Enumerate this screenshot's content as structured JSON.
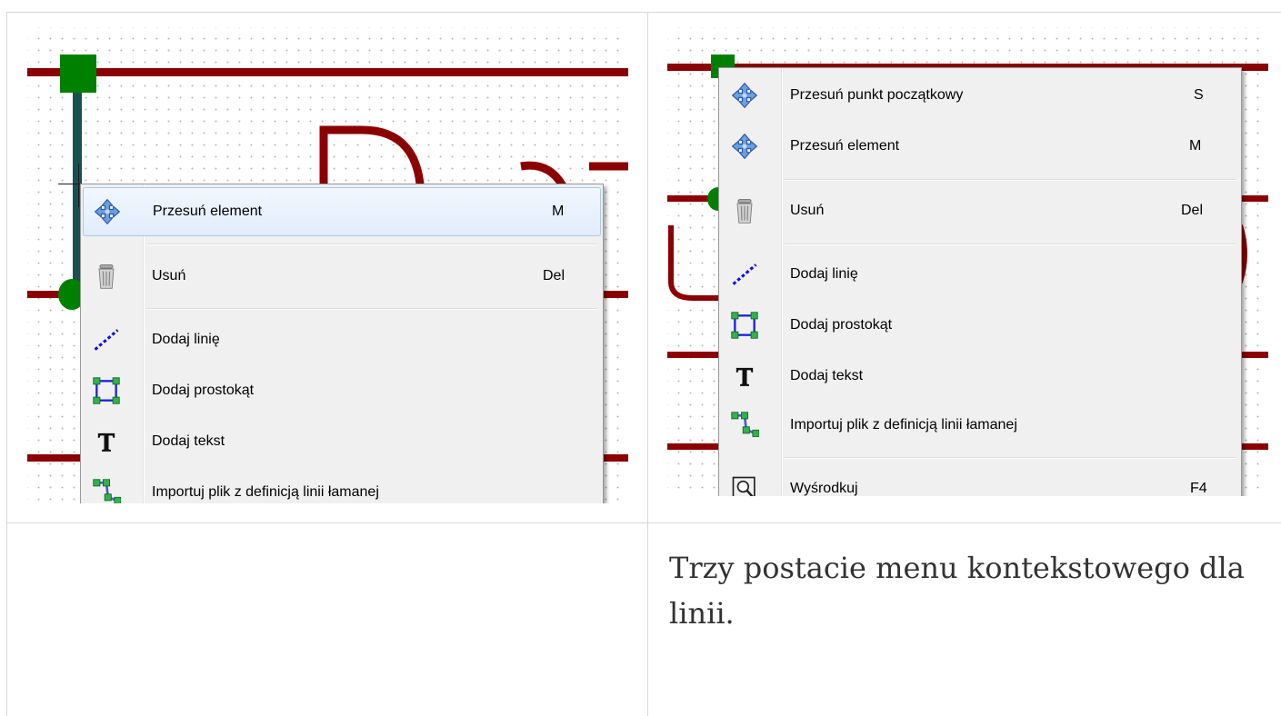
{
  "left_menu": {
    "items": [
      {
        "label": "Przesuń element",
        "shortcut": "M",
        "icon": "move-icon"
      },
      {
        "label": "Usuń",
        "shortcut": "Del",
        "icon": "trash-icon"
      },
      {
        "label": "Dodaj linię",
        "shortcut": "",
        "icon": "add-line-icon"
      },
      {
        "label": "Dodaj prostokąt",
        "shortcut": "",
        "icon": "add-rectangle-icon"
      },
      {
        "label": "Dodaj tekst",
        "shortcut": "",
        "icon": "add-text-icon"
      },
      {
        "label": "Importuj plik z definicją linii łamanej",
        "shortcut": "",
        "icon": "import-polyline-icon"
      }
    ]
  },
  "right_menu": {
    "items": [
      {
        "label": "Przesuń punkt początkowy",
        "shortcut": "S",
        "icon": "move-icon"
      },
      {
        "label": "Przesuń element",
        "shortcut": "M",
        "icon": "move-icon"
      },
      {
        "label": "Usuń",
        "shortcut": "Del",
        "icon": "trash-icon"
      },
      {
        "label": "Dodaj linię",
        "shortcut": "",
        "icon": "add-line-icon"
      },
      {
        "label": "Dodaj prostokąt",
        "shortcut": "",
        "icon": "add-rectangle-icon"
      },
      {
        "label": "Dodaj tekst",
        "shortcut": "",
        "icon": "add-text-icon"
      },
      {
        "label": "Importuj plik z definicją linii łamanej",
        "shortcut": "",
        "icon": "import-polyline-icon"
      },
      {
        "label": "Wyśrodkuj",
        "shortcut": "F4",
        "icon": "zoom-center-icon"
      }
    ]
  },
  "caption": "Trzy postacie menu kontekstowego dla linii.",
  "colors": {
    "wire": "#8b0000",
    "anchor": "#008000",
    "menu_bg": "#f0f0f0",
    "highlight": "#e1ecfb",
    "caption_text": "#333333"
  }
}
